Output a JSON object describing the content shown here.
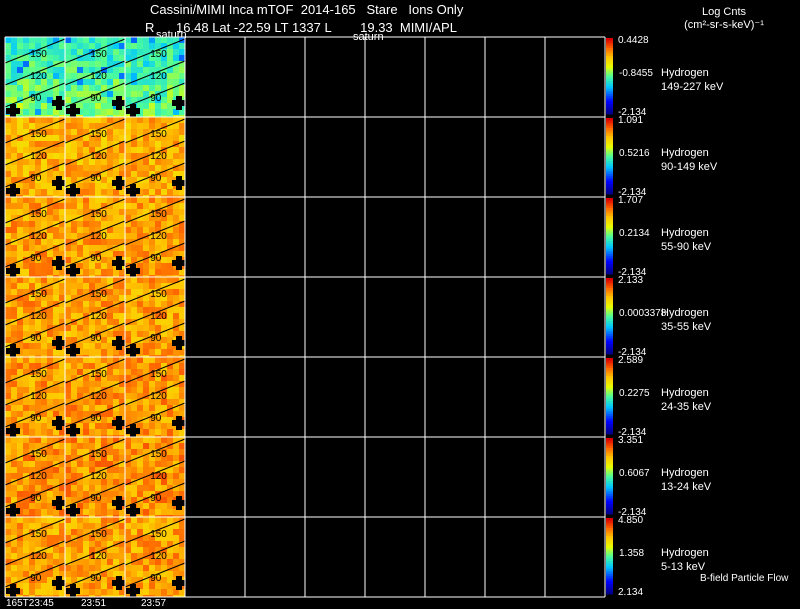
{
  "header": {
    "line1": "Cassini/MIMI Inca mTOF  2014-165   Stare   Ions Only",
    "line2": "R      16.48 Lat -22.59 LT 1337 L        19.33  MIMI/APL",
    "saturn_a": "saturn",
    "saturn_b": "saturn"
  },
  "legend_header": {
    "line1": "Log Cnts",
    "line2": "(cm²-sr-s-keV)⁻¹"
  },
  "footer": {
    "right": "B-field Particle Flow"
  },
  "time_labels": [
    "165T23:45",
    "23:51",
    "23:57"
  ],
  "angle_labels": [
    "150",
    "120",
    "90"
  ],
  "colors": {
    "background": "#000000",
    "grid": "#ffffff",
    "contour": "#000000"
  },
  "chart_data": {
    "type": "heatmap",
    "columns_total": 10,
    "columns_with_data": 3,
    "rows": [
      {
        "species": "Hydrogen",
        "energy": "149-227 keV",
        "cmax": "0.4428",
        "cmid": "-0.8455",
        "cmin": "-2.134",
        "mean_level": 0.55
      },
      {
        "species": "Hydrogen",
        "energy": "90-149 keV",
        "cmax": "1.091",
        "cmid": "0.5216",
        "cmin": "-2.134",
        "mean_level": 0.78
      },
      {
        "species": "Hydrogen",
        "energy": "55-90 keV",
        "cmax": "1.707",
        "cmid": "0.2134",
        "cmin": "-2.134",
        "mean_level": 0.8
      },
      {
        "species": "Hydrogen",
        "energy": "35-55 keV",
        "cmax": "2.133",
        "cmid": "0.0003378",
        "cmin": "-2.134",
        "mean_level": 0.8
      },
      {
        "species": "Hydrogen",
        "energy": "24-35 keV",
        "cmax": "2.589",
        "cmid": "0.2275",
        "cmin": "-2.134",
        "mean_level": 0.81
      },
      {
        "species": "Hydrogen",
        "energy": "13-24 keV",
        "cmax": "3.351",
        "cmid": "0.6067",
        "cmin": "-2.134",
        "mean_level": 0.82
      },
      {
        "species": "Hydrogen",
        "energy": "5-13 keV",
        "cmax": "4.850",
        "cmid": "1.358",
        "cmin": "2.134",
        "mean_level": 0.8
      }
    ]
  }
}
